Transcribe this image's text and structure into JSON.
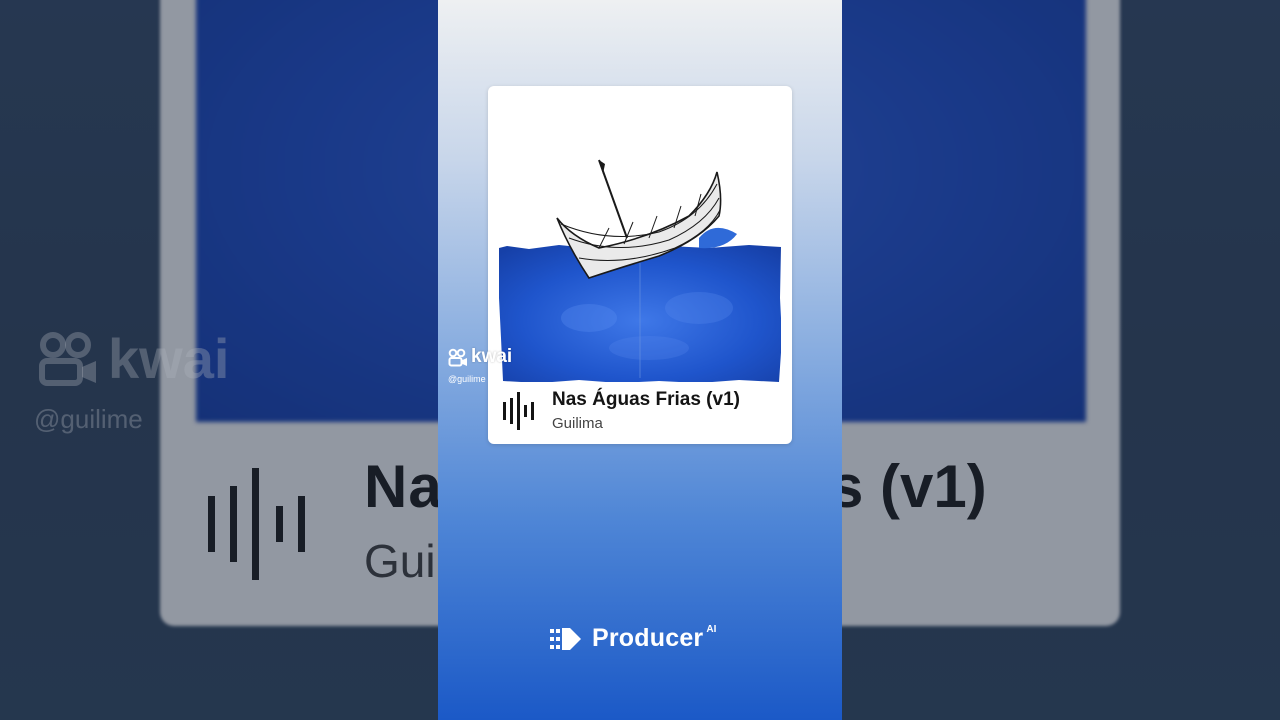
{
  "song": {
    "title": "Nas Águas Frias (v1)",
    "artist": "Guilima"
  },
  "watermark": {
    "brand": "kwai",
    "handle": "@guilime"
  },
  "background": {
    "title_left": "Na",
    "title_right": "s (v1)",
    "artist_partial": "Gui",
    "handle": "@guilime",
    "brand": "kwai"
  },
  "footer": {
    "brand": "Producer",
    "superscript": "AI"
  },
  "icons": {
    "waveform": "waveform-icon",
    "kwai": "kwai-logo-icon",
    "producer": "producer-logo-icon"
  },
  "colors": {
    "panel_top": "#eef0f2",
    "panel_bottom": "#1b59c7",
    "water": "#1d4fc4",
    "card": "#ffffff"
  }
}
